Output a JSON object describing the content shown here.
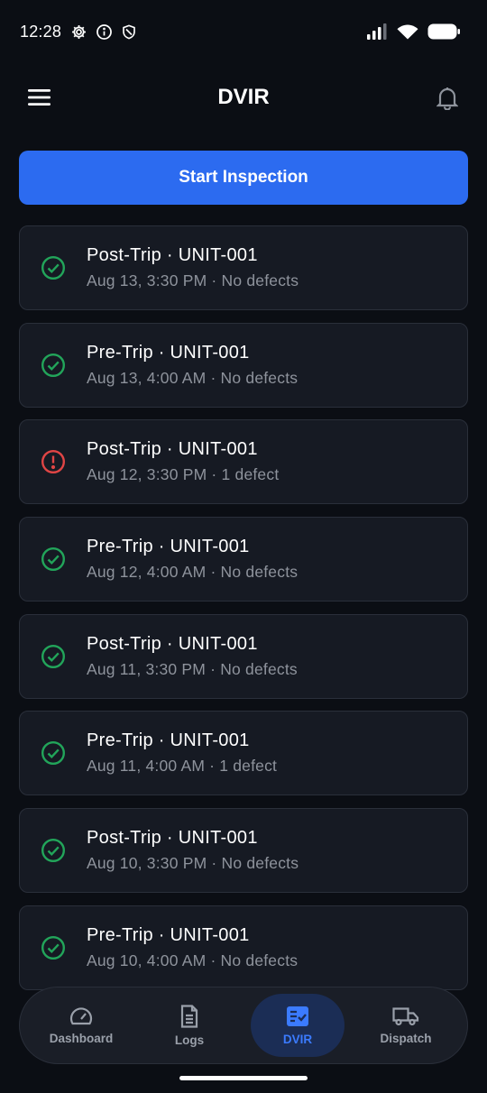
{
  "status_bar": {
    "time": "12:28"
  },
  "app_bar": {
    "title": "DVIR"
  },
  "start_button": {
    "label": "Start Inspection"
  },
  "colors": {
    "accent": "#2c6bf0",
    "ok": "#22a55a",
    "defect": "#e04545",
    "background": "#0b0e14"
  },
  "inspections": [
    {
      "title": "Post-Trip · UNIT-001",
      "subtitle": "Aug 13, 3:30 PM · No defects",
      "status": "check-circle-icon"
    },
    {
      "title": "Pre-Trip · UNIT-001",
      "subtitle": "Aug 13, 4:00 AM · No defects",
      "status": "check-circle-icon"
    },
    {
      "title": "Post-Trip · UNIT-001",
      "subtitle": "Aug 12, 3:30 PM · 1 defect",
      "status": "alert-circle-icon"
    },
    {
      "title": "Pre-Trip · UNIT-001",
      "subtitle": "Aug 12, 4:00 AM · No defects",
      "status": "check-circle-icon"
    },
    {
      "title": "Post-Trip · UNIT-001",
      "subtitle": "Aug 11, 3:30 PM · No defects",
      "status": "check-circle-icon"
    },
    {
      "title": "Pre-Trip · UNIT-001",
      "subtitle": "Aug 11, 4:00 AM · 1 defect",
      "status": "check-circle-icon"
    },
    {
      "title": "Post-Trip · UNIT-001",
      "subtitle": "Aug 10, 3:30 PM · No defects",
      "status": "check-circle-icon"
    },
    {
      "title": "Pre-Trip · UNIT-001",
      "subtitle": "Aug 10, 4:00 AM · No defects",
      "status": "check-circle-icon"
    }
  ],
  "bottom_nav": {
    "items": [
      {
        "label": "Dashboard",
        "icon": "speedometer-icon"
      },
      {
        "label": "Logs",
        "icon": "document-icon"
      },
      {
        "label": "DVIR",
        "icon": "checklist-icon",
        "active": true
      },
      {
        "label": "Dispatch",
        "icon": "truck-icon"
      }
    ]
  }
}
